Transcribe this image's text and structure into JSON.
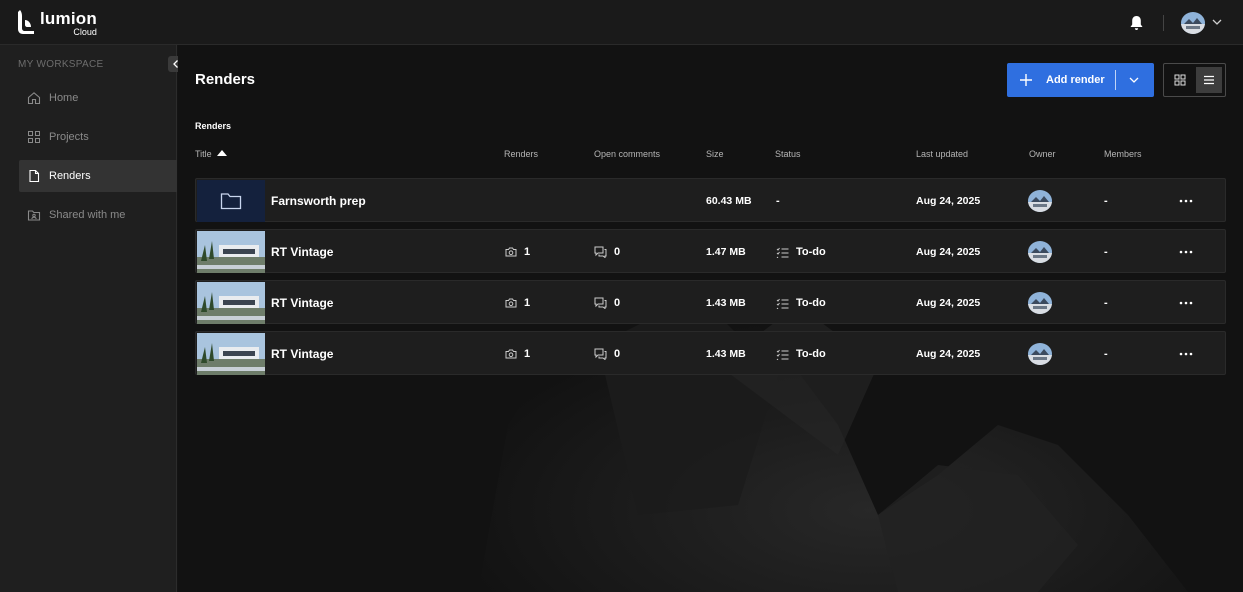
{
  "app": {
    "logo_name": "lumion",
    "logo_sub": "Cloud"
  },
  "sidebar": {
    "section_label": "MY WORKSPACE",
    "items": [
      {
        "label": "Home",
        "icon": "home-icon"
      },
      {
        "label": "Projects",
        "icon": "grid-icon"
      },
      {
        "label": "Renders",
        "icon": "file-icon",
        "active": true
      },
      {
        "label": "Shared with me",
        "icon": "shared-folder-icon"
      }
    ]
  },
  "main": {
    "title": "Renders",
    "add_button_label": "Add render",
    "breadcrumb": "Renders",
    "columns": {
      "title": "Title",
      "renders": "Renders",
      "comments": "Open comments",
      "size": "Size",
      "status": "Status",
      "updated": "Last updated",
      "owner": "Owner",
      "members": "Members"
    },
    "rows": [
      {
        "kind": "folder",
        "title": "Farnsworth prep",
        "renders": "",
        "comments": "",
        "size": "60.43 MB",
        "status": "-",
        "updated": "Aug 24, 2025",
        "members": "-"
      },
      {
        "kind": "render",
        "title": "RT Vintage",
        "renders": "1",
        "comments": "0",
        "size": "1.47 MB",
        "status": "To-do",
        "updated": "Aug 24, 2025",
        "members": "-"
      },
      {
        "kind": "render",
        "title": "RT Vintage",
        "renders": "1",
        "comments": "0",
        "size": "1.43 MB",
        "status": "To-do",
        "updated": "Aug 24, 2025",
        "members": "-"
      },
      {
        "kind": "render",
        "title": "RT Vintage",
        "renders": "1",
        "comments": "0",
        "size": "1.43 MB",
        "status": "To-do",
        "updated": "Aug 24, 2025",
        "members": "-"
      }
    ]
  },
  "colors": {
    "accent": "#2f6fe0",
    "background": "#121212",
    "sidebar": "#1f1f1f",
    "row": "#1e1e1e"
  }
}
